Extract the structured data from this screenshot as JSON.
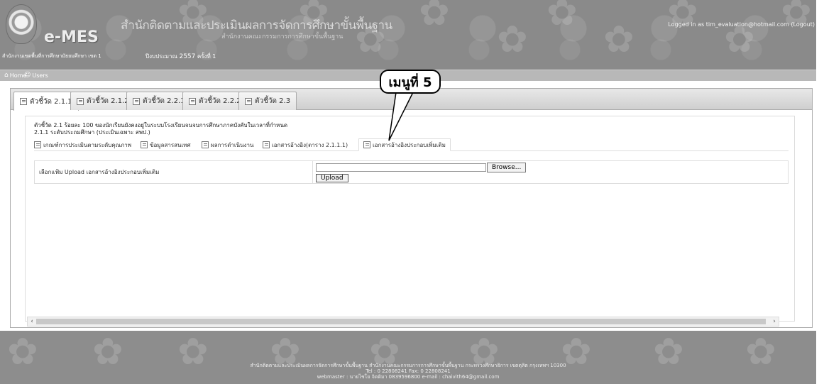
{
  "header": {
    "brand": "e-MES",
    "title": "สำนักติดตามและประเมินผลการจัดการศึกษาขั้นพื้นฐาน",
    "subtitle": "สำนักงานคณะกรรมการการศึกษาขั้นพื้นฐาน",
    "office": "สำนักงานเขตพื้นที่การศึกษามัธยมศึกษา เขต 1",
    "budget_label": "ปีงบประมาณ",
    "budget_year": "2557",
    "budget_round": "ครั้งที่ 1",
    "logged_in": "Logged in as tim_evaluation@hotmail.com (Logout)"
  },
  "nav": {
    "items": [
      {
        "label": "Home",
        "icon": "home-icon"
      },
      {
        "label": "Users",
        "icon": "users-icon"
      }
    ]
  },
  "tabs": [
    {
      "label": "ตัวชี้วัด 2.1.1",
      "active": true
    },
    {
      "label": "ตัวชี้วัด 2.1.2",
      "active": false
    },
    {
      "label": "ตัวชี้วัด 2.2.1",
      "active": false
    },
    {
      "label": "ตัวชี้วัด 2.2.2",
      "active": false
    },
    {
      "label": "ตัวชี้วัด 2.3",
      "active": false
    }
  ],
  "indicator": {
    "line1": "ตัวชี้วัด 2.1 ร้อยละ 100 ของนักเรียนยังคงอยู่ในระบบโรงเรียนจนจบการศึกษาภาคบังคับในเวลาที่กำหนด",
    "line2": "2.1.1 ระดับประถมศึกษา (ประเมินเฉพาะ สพป.)"
  },
  "subtabs": [
    {
      "label": "เกณฑ์การประเมินตามระดับคุณภาพ",
      "active": false
    },
    {
      "label": "ข้อมูลสารสนเทศ",
      "active": false
    },
    {
      "label": "ผลการดำเนินงาน",
      "active": false
    },
    {
      "label": "เอกสารอ้างอิง(ตาราง 2.1.1.1)",
      "active": false
    },
    {
      "label": "เอกสารอ้างอิงประกอบเพิ่มเติม",
      "active": true
    }
  ],
  "upload": {
    "label": "เลือกแฟ้ม Upload เอกสารอ้างอิงประกอบเพิ่มเติม",
    "browse_label": "Browse...",
    "upload_label": "Upload"
  },
  "callout": {
    "text": "เมนูที่ 5"
  },
  "footer": {
    "line1": "สำนักติดตามและประเมินผลการจัดการศึกษาขั้นพื้นฐาน สำนักงานคณะกรรมการการศึกษาขั้นพื้นฐาน กระทรวงศึกษาธิการ เขตดุสิต กรุงเทพฯ 10300",
    "line2": "Tel : 0 22808241 Fax: 0 22808241",
    "line3": "webmaster : นายไชโย จิตติมา 0839596800 e-mail : chaivith64@gmail.com"
  },
  "colors": {
    "header_bg": "#8a8a8a",
    "nav_bg": "#b8b8b8",
    "footer_bg": "#8d8d8d"
  }
}
